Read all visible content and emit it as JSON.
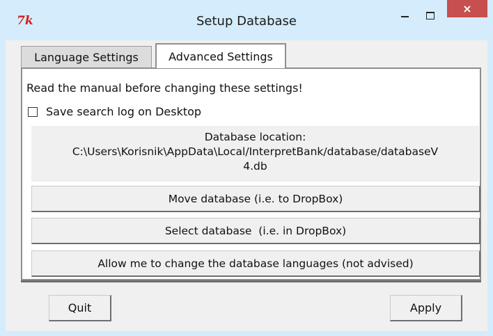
{
  "window": {
    "app_icon": "7k",
    "title": "Setup Database",
    "controls": {
      "minimize": "minimize-icon",
      "maximize": "maximize-icon",
      "close": "×"
    }
  },
  "tabs": [
    {
      "label": "Language Settings",
      "selected": false
    },
    {
      "label": "Advanced Settings",
      "selected": true
    }
  ],
  "advanced": {
    "warning": "Read the manual before changing these settings!",
    "save_log": {
      "label": "Save search log on Desktop",
      "checked": false
    },
    "database_location": {
      "line1": "Database location:",
      "line2": "C:\\Users\\Korisnik\\AppData\\Local/InterpretBank/database/databaseV",
      "line3": "4.db"
    },
    "buttons": {
      "move": "Move database (i.e. to DropBox)",
      "select": "Select database  (i.e. in DropBox)",
      "allow_change": "Allow me to change the database languages (not advised)"
    }
  },
  "footer": {
    "quit": "Quit",
    "apply": "Apply"
  },
  "colors": {
    "titlebar": "#d4ecfb",
    "close_button": "#c74f4f",
    "app_icon": "#d21f1f"
  }
}
